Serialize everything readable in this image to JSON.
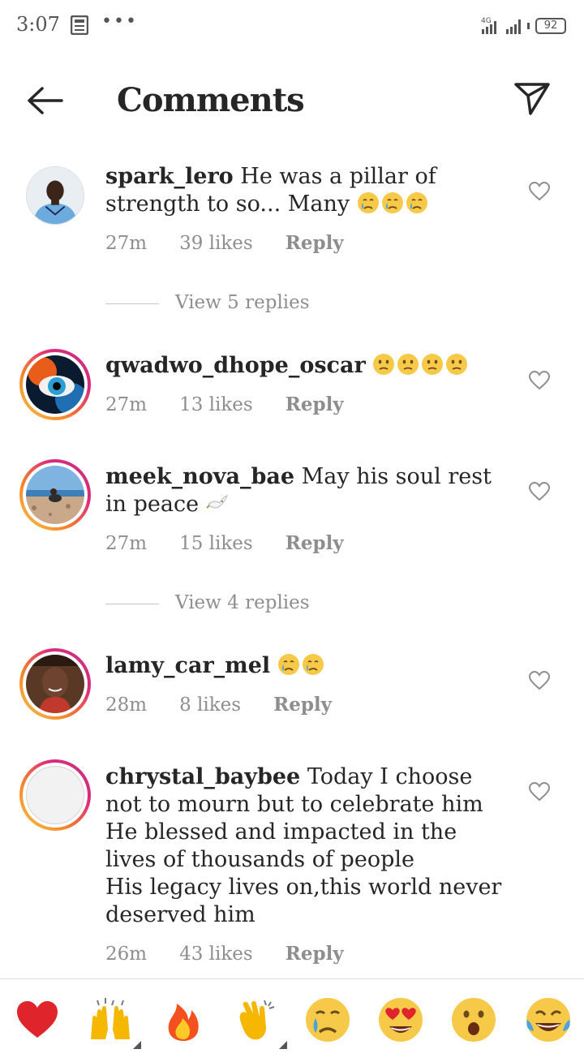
{
  "status_bar": {
    "time": "3:07",
    "dots": "•••",
    "network": "4G",
    "battery": "92",
    "icons": [
      "news-icon",
      "signal-icon",
      "battery-icon"
    ]
  },
  "header": {
    "title": "Comments",
    "back_icon": "arrow-left-icon",
    "send_icon": "paper-plane-icon"
  },
  "comments": [
    {
      "username": "spark_lero",
      "text": "He was a pillar of strength to so... Many",
      "emojis": [
        "crying-face",
        "crying-face",
        "crying-face"
      ],
      "time": "27m",
      "likes": "39 likes",
      "reply": "Reply",
      "view_replies": "View 5 replies"
    },
    {
      "username": "qwadwo_dhope_oscar",
      "text": "",
      "emojis": [
        "confused-face",
        "confused-face",
        "confused-face",
        "confused-face"
      ],
      "time": "27m",
      "likes": "13 likes",
      "reply": "Reply"
    },
    {
      "username": "meek_nova_bae",
      "text": "May his soul rest in peace",
      "emojis": [
        "dove"
      ],
      "time": "27m",
      "likes": "15 likes",
      "reply": "Reply",
      "view_replies": "View 4 replies"
    },
    {
      "username": "lamy_car_mel",
      "text": "",
      "emojis": [
        "crying-face",
        "crying-face"
      ],
      "time": "28m",
      "likes": "8 likes",
      "reply": "Reply"
    },
    {
      "username": "chrystal_baybee",
      "text": "Today I choose not to mourn but to celebrate him\nHe blessed and impacted in the lives of thousands of people\nHis legacy lives on,this world never deserved him",
      "emojis": [],
      "time": "26m",
      "likes": "43 likes",
      "reply": "Reply"
    }
  ],
  "reactions": [
    "red-heart",
    "raising-hands",
    "fire",
    "clapping-hands",
    "crying-face",
    "heart-eyes",
    "open-mouth-face",
    "tears-of-joy"
  ],
  "colors": {
    "text": "#262626",
    "meta": "#8e8e8e",
    "heart": "#e0245e",
    "emoji_yellow": "#f7c948"
  }
}
